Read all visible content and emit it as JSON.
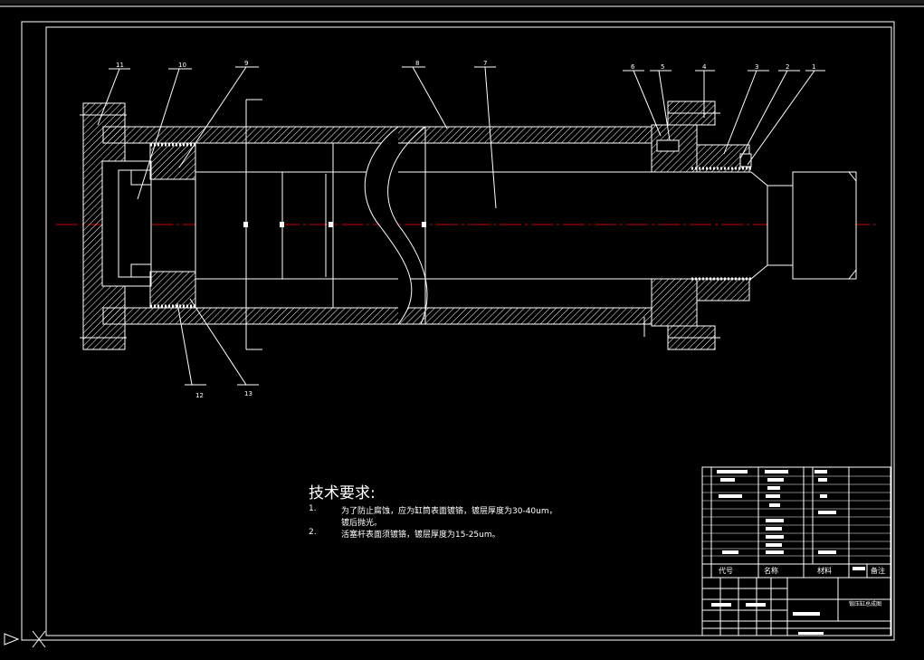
{
  "drawing": {
    "part_numbers": [
      "1",
      "2",
      "3",
      "4",
      "5",
      "6",
      "7",
      "8",
      "9",
      "10",
      "11",
      "12",
      "13"
    ],
    "tech_requirements": {
      "title": "技术要求:",
      "items": [
        {
          "num": "1.",
          "text": "为了防止腐蚀，应为缸筒表面镀铬，镀层厚度为30-40um，"
        },
        {
          "num": "",
          "text": "镀后抛光。"
        },
        {
          "num": "2.",
          "text": "活塞杆表面须镀铬，镀层厚度为15-25um。"
        }
      ]
    },
    "title_block": {
      "col_code": "代号",
      "col_name": "名称",
      "col_material": "材料",
      "col_remark": "备注",
      "drawing_title": "锻压缸总成图"
    }
  },
  "colors": {
    "background": "#000000",
    "lines": "#ffffff",
    "centerline": "#cc0000",
    "hatch": "#ffffff"
  }
}
